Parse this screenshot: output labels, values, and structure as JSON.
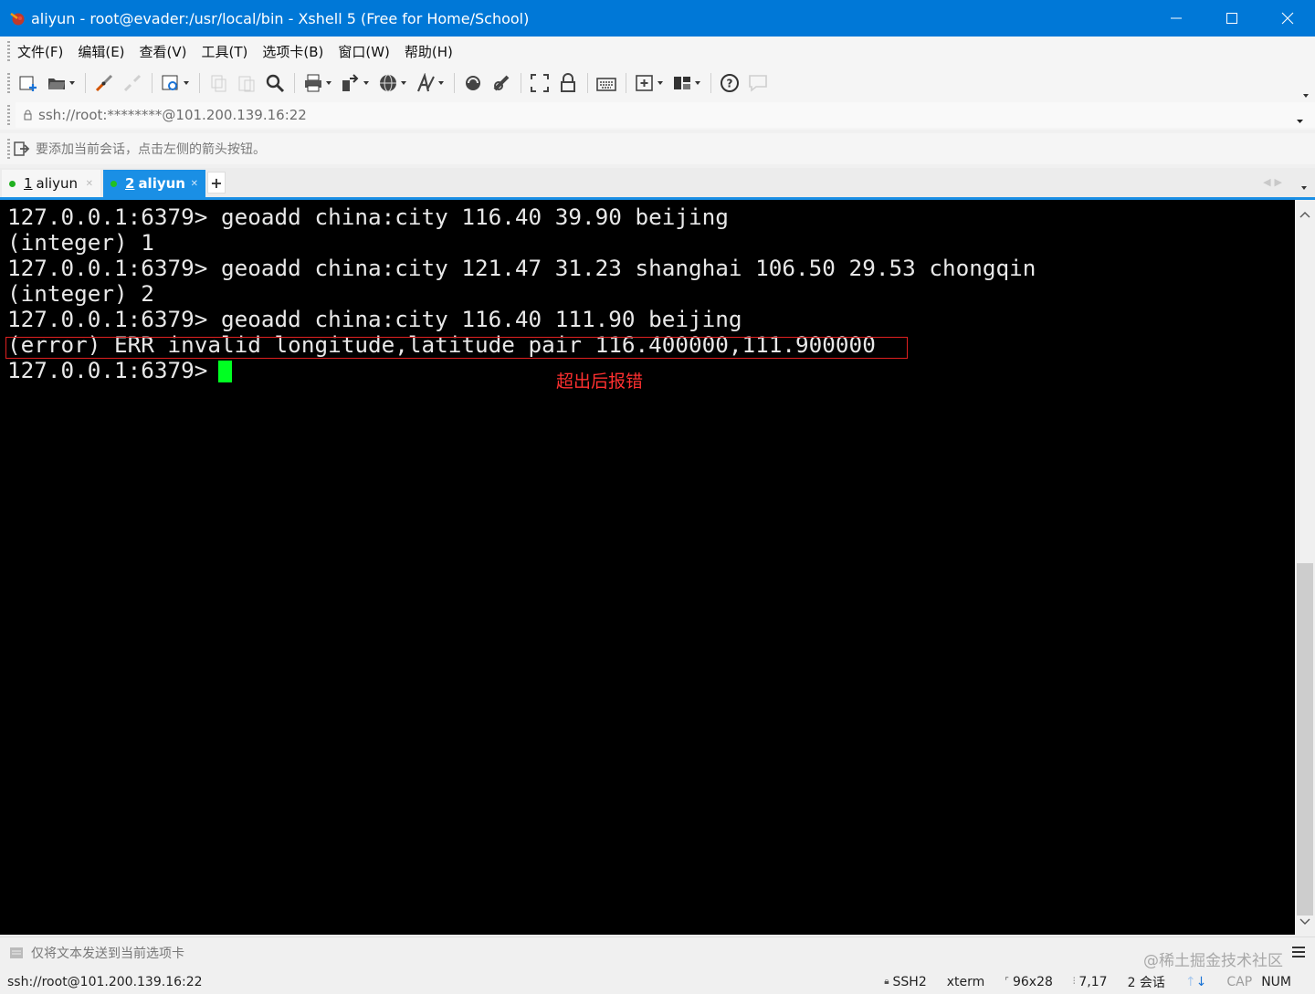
{
  "window": {
    "title": "aliyun - root@evader:/usr/local/bin - Xshell 5 (Free for Home/School)",
    "minimize_icon": "minimize-icon",
    "maximize_icon": "maximize-icon",
    "close_icon": "close-icon"
  },
  "menu": [
    "文件(F)",
    "编辑(E)",
    "查看(V)",
    "工具(T)",
    "选项卡(B)",
    "窗口(W)",
    "帮助(H)"
  ],
  "toolbar": {
    "icons": [
      "new-session-icon",
      "open-folder-icon",
      "reconnect-icon",
      "disconnect-icon",
      "properties-icon",
      "copy-icon",
      "paste-icon",
      "find-icon",
      "print-icon",
      "transfer-icon",
      "globe-icon",
      "font-icon",
      "xftp-icon",
      "tunnel-icon",
      "fullscreen-icon",
      "lock-icon",
      "keyboard-icon",
      "add-session-icon",
      "layout-icon",
      "help-icon",
      "chat-icon"
    ]
  },
  "address": {
    "text": "ssh://root:********@101.200.139.16:22"
  },
  "hint": {
    "text": "要添加当前会话，点击左侧的箭头按钮。"
  },
  "tabs": [
    {
      "number": "1",
      "label": "aliyun",
      "active": false
    },
    {
      "number": "2",
      "label": "aliyun",
      "active": true
    }
  ],
  "terminal": {
    "lines": [
      "127.0.0.1:6379> geoadd china:city 116.40 39.90 beijing",
      "(integer) 1",
      "127.0.0.1:6379> geoadd china:city 121.47 31.23 shanghai 106.50 29.53 chongqin",
      "(integer) 2",
      "127.0.0.1:6379> geoadd china:city 116.40 111.90 beijing",
      "(error) ERR invalid longitude,latitude pair 116.400000,111.900000",
      "127.0.0.1:6379> "
    ],
    "annotation": "超出后报错",
    "annotation_color": "#ff3030",
    "cursor_color": "#00ff22"
  },
  "compose": {
    "text": "仅将文本发送到当前选项卡"
  },
  "watermark": "@稀土掘金技术社区",
  "status": {
    "connection": "ssh://root@101.200.139.16:22",
    "protocol": "SSH2",
    "terminal_type": "xterm",
    "size": "96x28",
    "position": "7,17",
    "sessions": "2 会话",
    "cap": "CAP",
    "num": "NUM"
  },
  "colors": {
    "accent": "#0078d7",
    "tab_active": "#1a8fe5"
  }
}
